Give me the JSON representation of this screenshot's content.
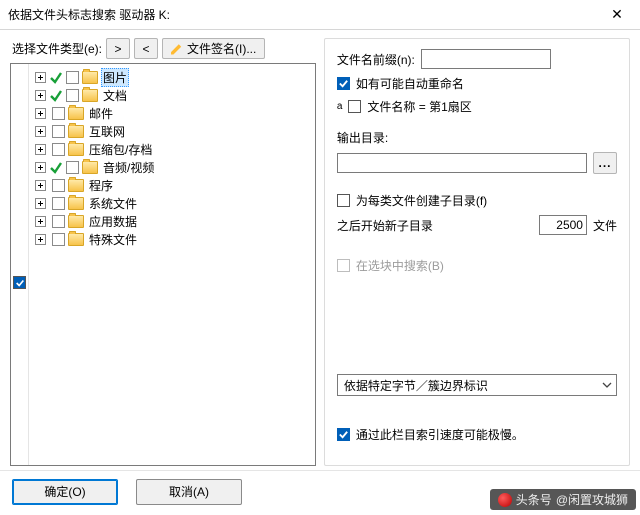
{
  "window": {
    "title": "依据文件头标志搜索 驱动器 K:",
    "close": "✕"
  },
  "left": {
    "type_label": "选择文件类型(e):",
    "btn_next": ">",
    "btn_prev": "<",
    "btn_sig": "文件签名(I)...",
    "master_checked": true,
    "tree": [
      {
        "label": "图片",
        "ticked": true,
        "selected": true
      },
      {
        "label": "文档",
        "ticked": true,
        "selected": false
      },
      {
        "label": "邮件",
        "ticked": false,
        "selected": false
      },
      {
        "label": "互联网",
        "ticked": false,
        "selected": false
      },
      {
        "label": "压缩包/存档",
        "ticked": false,
        "selected": false
      },
      {
        "label": "音频/视频",
        "ticked": true,
        "selected": false
      },
      {
        "label": "程序",
        "ticked": false,
        "selected": false
      },
      {
        "label": "系统文件",
        "ticked": false,
        "selected": false
      },
      {
        "label": "应用数据",
        "ticked": false,
        "selected": false
      },
      {
        "label": "特殊文件",
        "ticked": false,
        "selected": false
      }
    ]
  },
  "right": {
    "prefix_label": "文件名前缀(n):",
    "prefix_value": "",
    "auto_rename": "如有可能自动重命名",
    "auto_rename_checked": true,
    "name_sector_mark": "a",
    "name_sector": "文件名称 = 第1扇区",
    "name_sector_checked": false,
    "outdir_label": "输出目录:",
    "outdir_value": "",
    "browse": "...",
    "mkdir_each": "为每类文件创建子目录(f)",
    "mkdir_each_checked": false,
    "newdir_label": "之后开始新子目录",
    "newdir_count": "2500",
    "newdir_unit": "文件",
    "search_in_sel": "在选块中搜索(B)",
    "search_in_sel_enabled": false,
    "combo_value": "依据特定字节／簇边界标识",
    "slow_warning": "通过此栏目索引速度可能极慢。",
    "slow_checked": true
  },
  "footer": {
    "ok": "确定(O)",
    "cancel": "取消(A)",
    "wm_source": "头条号",
    "wm_author": "@闲置攻城狮"
  }
}
